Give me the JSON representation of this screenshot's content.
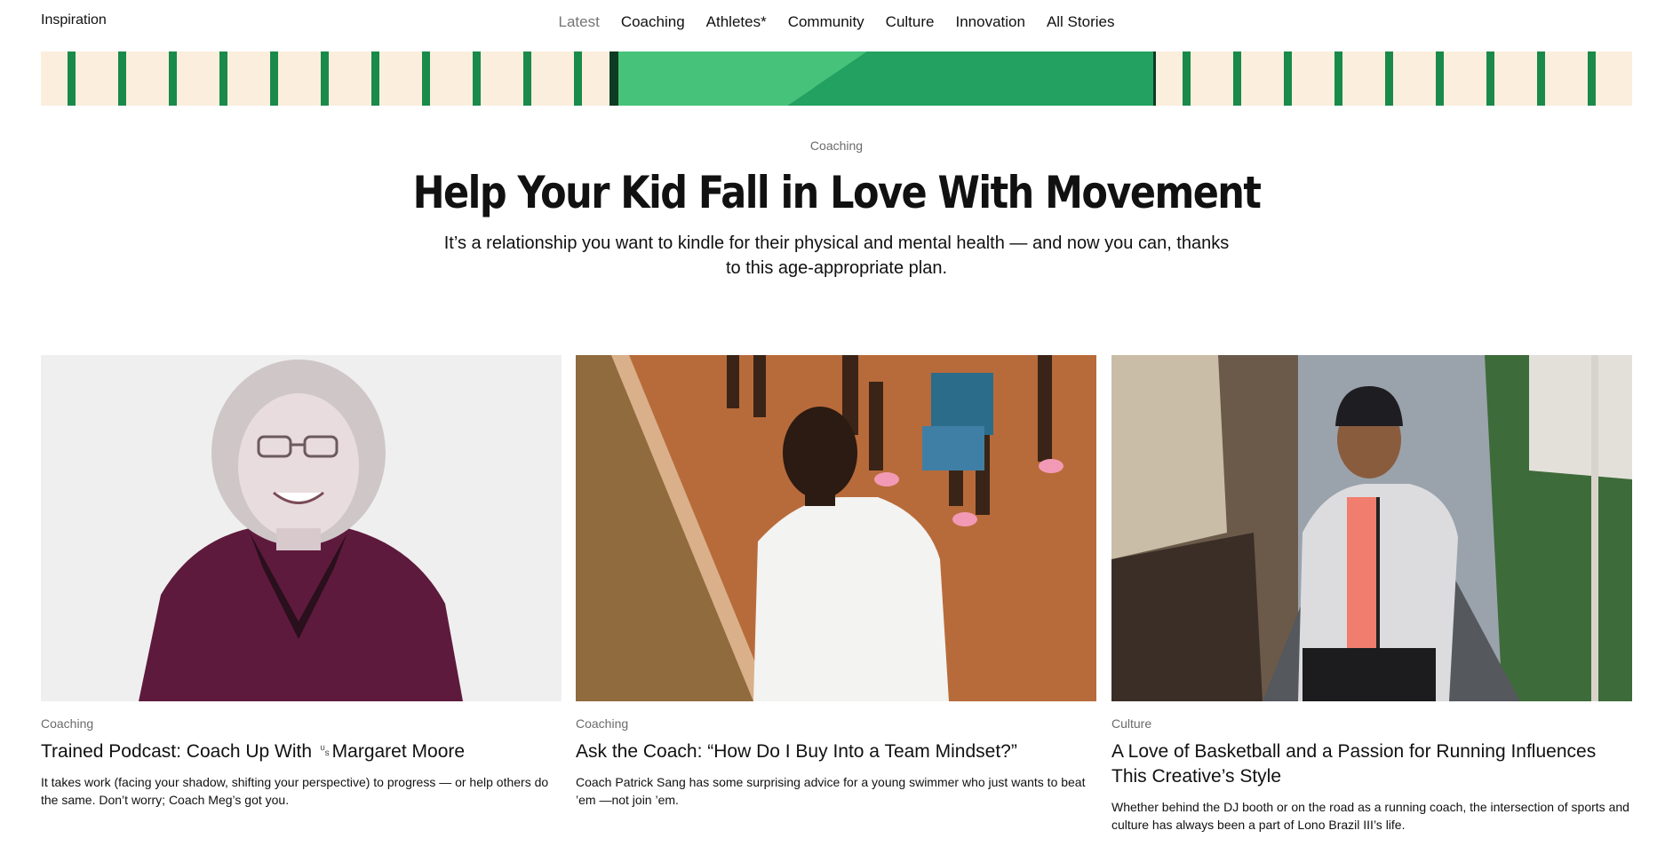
{
  "brand": "Inspiration",
  "nav": {
    "items": [
      {
        "label": "Latest"
      },
      {
        "label": "Coaching"
      },
      {
        "label": "Athletes*"
      },
      {
        "label": "Community"
      },
      {
        "label": "Culture"
      },
      {
        "label": "Innovation"
      },
      {
        "label": "All Stories"
      }
    ],
    "active": "Latest"
  },
  "hero": {
    "category": "Coaching",
    "title": "Help Your Kid Fall in Love With Movement",
    "subtitle": "It’s a relationship you want to kindle for their physical and mental health — and now you can, thanks to this age-appropriate plan."
  },
  "cards": [
    {
      "category": "Coaching",
      "title": "Trained Podcast: Coach Up With ␟Margaret Moore",
      "description": "It takes work (facing your shadow, shifting your perspective) to progress — or help others do the same. Don’t worry; Coach Meg’s got you."
    },
    {
      "category": "Coaching",
      "title": "Ask the Coach: “How Do I Buy Into a Team Mindset?”",
      "description": "Coach Patrick Sang has some surprising advice for a young swimmer who just wants to beat ’em —not join ’em."
    },
    {
      "category": "Culture",
      "title": "A Love of Basketball and a Passion for Running Influences This Creative’s Style",
      "description": "Whether behind the DJ booth or on the road as a running coach, the intersection of sports and culture has always been a part of Lono Brazil III’s life."
    }
  ],
  "colors": {
    "stripe_green": "#1a8a4a",
    "hero_block_green": "#2bb56a",
    "strip_background": "#fbeedd",
    "portrait_plum": "#5e1a3c",
    "muted_text": "#6b6b6b"
  }
}
